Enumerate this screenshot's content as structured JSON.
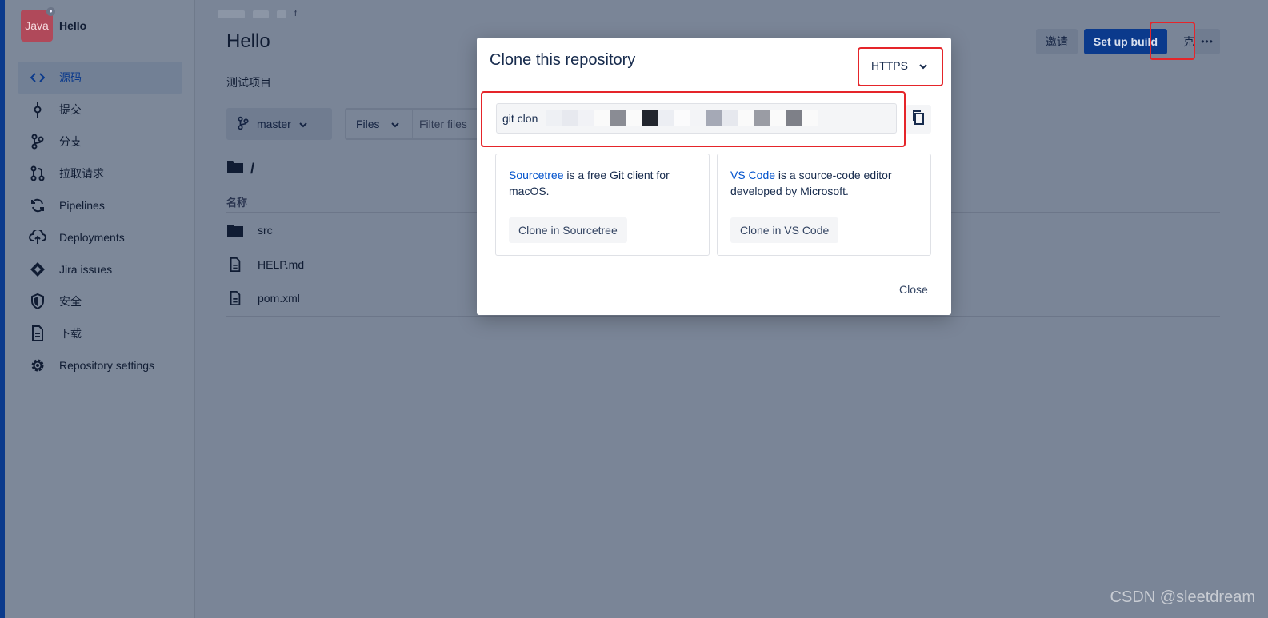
{
  "project": {
    "avatar_text": "Java",
    "name": "Hello"
  },
  "sidebar": {
    "items": [
      {
        "label": "源码",
        "icon": "code-icon",
        "active": true
      },
      {
        "label": "提交",
        "icon": "commit-icon"
      },
      {
        "label": "分支",
        "icon": "branch-icon"
      },
      {
        "label": "拉取请求",
        "icon": "pull-request-icon"
      },
      {
        "label": "Pipelines",
        "icon": "pipelines-icon"
      },
      {
        "label": "Deployments",
        "icon": "deployments-icon"
      },
      {
        "label": "Jira issues",
        "icon": "jira-icon"
      },
      {
        "label": "安全",
        "icon": "shield-icon"
      },
      {
        "label": "下载",
        "icon": "download-icon"
      },
      {
        "label": "Repository settings",
        "icon": "gear-icon"
      }
    ]
  },
  "breadcrumb": {
    "fragment": "f"
  },
  "page": {
    "title": "Hello",
    "description": "测试项目"
  },
  "header_buttons": {
    "invite": "邀请",
    "setup_build": "Set up build",
    "clone": "克隆",
    "more": "•••"
  },
  "toolbar": {
    "branch": "master",
    "files": "Files",
    "filter_placeholder": "Filter files"
  },
  "path": "/",
  "file_list": {
    "column_name": "名称",
    "rows": [
      {
        "name": "src",
        "type": "folder"
      },
      {
        "name": "HELP.md",
        "type": "file"
      },
      {
        "name": "pom.xml",
        "type": "file"
      }
    ]
  },
  "modal": {
    "title": "Clone this repository",
    "protocol": "HTTPS",
    "command_prefix": "git clon",
    "sourcetree": {
      "link": "Sourcetree",
      "text": " is a free Git client for macOS.",
      "button": "Clone in Sourcetree"
    },
    "vscode": {
      "link": "VS Code",
      "text": " is a source-code editor developed by Microsoft.",
      "button": "Clone in VS Code"
    },
    "close": "Close"
  },
  "watermark": "CSDN @sleetdream",
  "colors": {
    "accent": "#0b3a8c",
    "highlight": "#e5252a",
    "link": "#0052cc"
  }
}
